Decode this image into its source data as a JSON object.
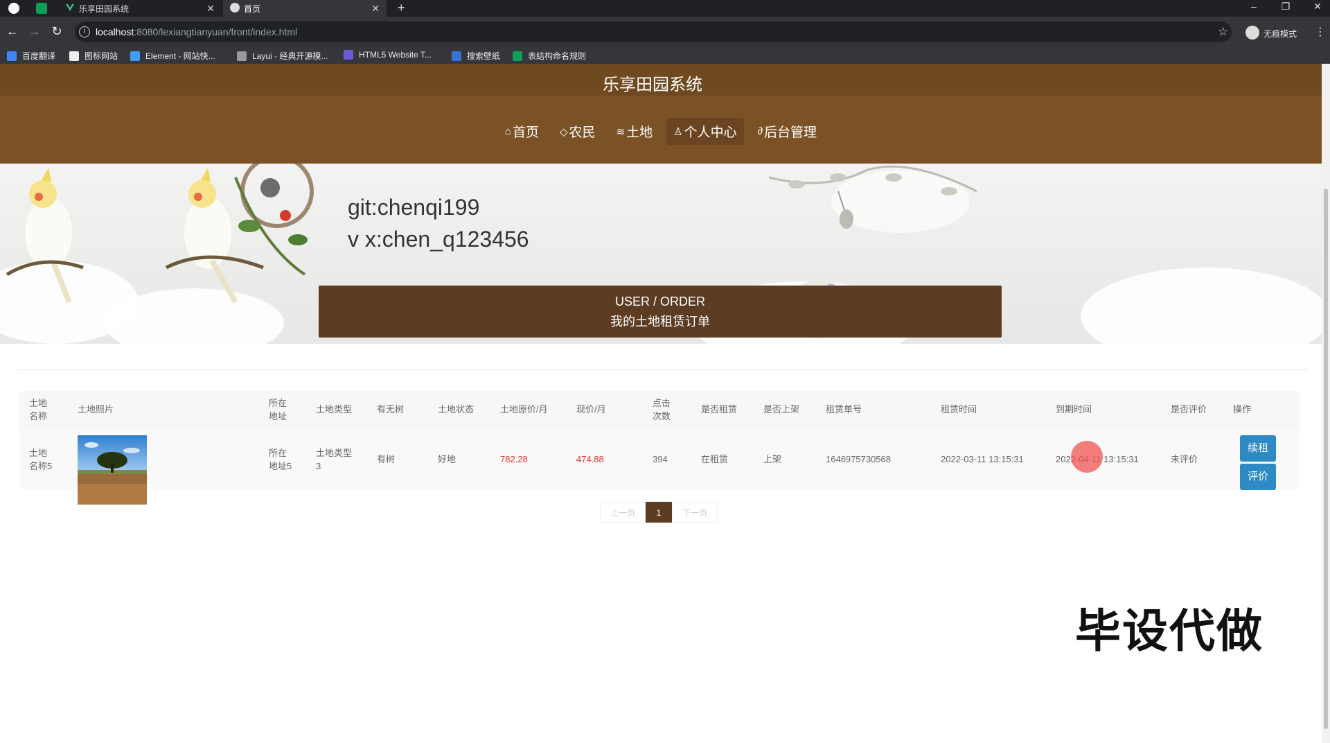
{
  "browser": {
    "tabs": [
      {
        "title": "乐享田园系统"
      },
      {
        "title": "首页"
      }
    ],
    "url_host": "localhost",
    "url_path": ":8080/lexiangtianyuan/front/index.html",
    "profile_label": "无痕模式",
    "bookmarks": [
      "百度翻译",
      "图标网站",
      "Element - 网站快...",
      "Layui - 经典开源模...",
      "HTML5 Website T...",
      "搜索壁纸",
      "表结构命名规则"
    ]
  },
  "site": {
    "title": "乐享田园系统",
    "nav": [
      {
        "icon": "home-icon",
        "label": "首页"
      },
      {
        "icon": "tag-icon",
        "label": "农民"
      },
      {
        "icon": "layers-icon",
        "label": "土地"
      },
      {
        "icon": "user-icon",
        "label": "个人中心"
      },
      {
        "icon": "link-icon",
        "label": "后台管理"
      }
    ],
    "active_nav": "个人中心"
  },
  "banner": {
    "line1": "git:chenqi199",
    "line2": "v x:chen_q123456"
  },
  "section": {
    "title_en": "USER / ORDER",
    "title_cn": "我的土地租赁订单"
  },
  "table": {
    "headers": {
      "name": [
        "土地",
        "名称"
      ],
      "photo": "土地照片",
      "addr": [
        "所在",
        "地址"
      ],
      "type": "土地类型",
      "tree": "有无树",
      "status": "土地状态",
      "orig_price": "土地原价/月",
      "cur_price": "现价/月",
      "clicks": [
        "点击",
        "次数"
      ],
      "rented": "是否租赁",
      "listed": "是否上架",
      "order_no": "租赁单号",
      "rent_time": "租赁时间",
      "expire_time": "到期时间",
      "reviewed": "是否评价",
      "action": "操作"
    },
    "row": {
      "name": [
        "土地",
        "名称5"
      ],
      "addr": [
        "所在",
        "地址5"
      ],
      "type": [
        "土地类型",
        "3"
      ],
      "tree": "有树",
      "status": "好地",
      "orig_price": "782.28",
      "cur_price": "474.88",
      "clicks": "394",
      "rented": "在租赁",
      "listed": "上架",
      "order_no": "1646975730568",
      "rent_time": "2022-03-11 13:15:31",
      "expire_time": "2022-04-11 13:15:31",
      "reviewed": "未评价",
      "btn_renew": "续租",
      "btn_review": "评价"
    }
  },
  "pager": {
    "prev": "上一页",
    "current": "1",
    "next": "下一页"
  },
  "watermark": "毕设代做",
  "colors": {
    "header_brown": "#7b5225",
    "section_brown": "#5c3d24",
    "button_blue": "#2d8ac3",
    "price_red": "#e2362b"
  }
}
